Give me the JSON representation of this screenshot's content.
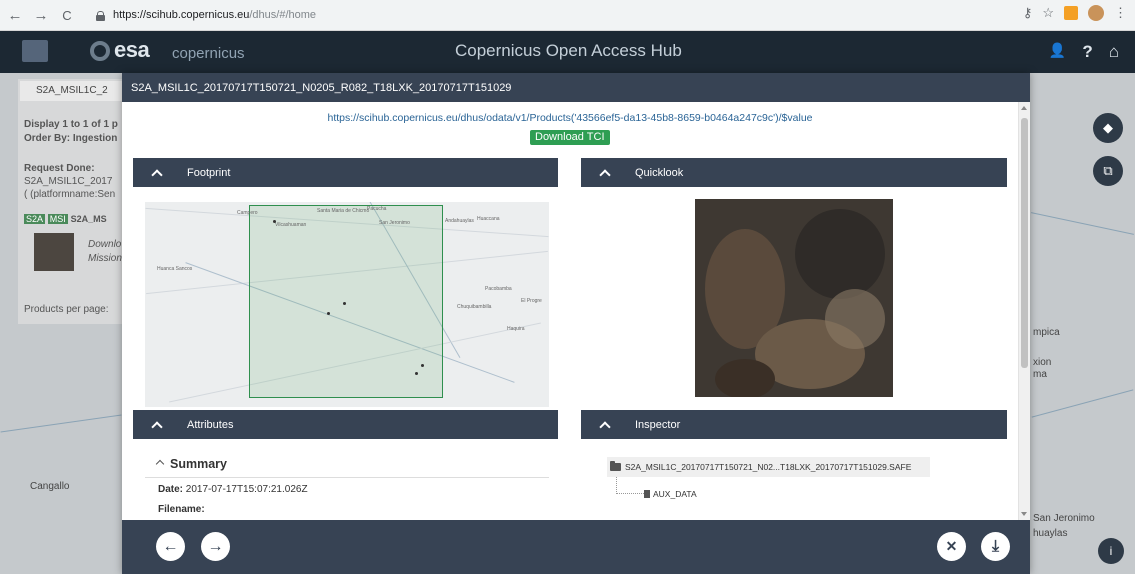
{
  "browser": {
    "back_icon": "←",
    "forward_icon": "→",
    "reload_icon": "C",
    "url_host": "https://scihub.copernicus.eu",
    "url_path": "/dhus/#/home",
    "key_icon": "⚷",
    "star_icon": "☆",
    "menu_icon": "⋮"
  },
  "header": {
    "esa_text": "esa",
    "copernicus_text": "opernicus",
    "copernicus_prefix": "c",
    "title": "Copernicus Open Access Hub",
    "user_icon": "👤",
    "help_icon": "?",
    "home_icon": "⌂"
  },
  "background": {
    "search_text": "S2A_MSIL1C_2",
    "display_text": "Display 1 to 1 of 1 p",
    "order_text": "Order By: Ingestion",
    "request_title": "Request Done:",
    "request_line1": "S2A_MSIL1C_2017",
    "request_line2": "( (platformname:Sen",
    "badge_s2a": "S2A",
    "badge_msi": "MSI",
    "badge_name": "S2A_MS",
    "item_download": "Downlo",
    "item_mission": "Mission",
    "products_per_page": "Products per page:",
    "map_label_cangallo": "Cangallo",
    "map_label_sanjeronimo": "San Jeronimo",
    "map_label_huaylas": "huaylas",
    "map_label_mpica": "mpica",
    "map_label_xion": "xion",
    "map_label_ma": "ma",
    "layers_icon": "◆",
    "footprint_icon": "⧉"
  },
  "modal": {
    "title": "S2A_MSIL1C_20170717T150721_N0205_R082_T18LXK_20170717T151029",
    "download_url": "https://scihub.copernicus.eu/dhus/odata/v1/Products('43566ef5-da13-45b8-8659-b0464a247c9c')/$value",
    "download_tci": "Download TCI",
    "sections": {
      "footprint": "Footprint",
      "quicklook": "Quicklook",
      "attributes": "Attributes",
      "inspector": "Inspector"
    },
    "map_towns": [
      "Campero",
      "Vilcashuaman",
      "Santa Maria de Chicmo",
      "Pacucha",
      "San Jeronimo",
      "Andahuaylas",
      "Huaccana",
      "Huanca Sancos",
      "Pacobamba",
      "Chuquibambilla",
      "Haquira",
      "El Progre"
    ],
    "summary": {
      "title": "Summary",
      "date_label": "Date:",
      "date_value": "2017-07-17T15:07:21.026Z",
      "filename_label": "Filename:"
    },
    "inspector": {
      "root": "S2A_MSIL1C_20170717T150721_N02...T18LXK_20170717T151029.SAFE",
      "child": "AUX_DATA"
    },
    "footer": {
      "prev_icon": "←",
      "next_icon": "→",
      "close_icon": "✕",
      "download_icon": "⤓"
    }
  },
  "info_icon": "i"
}
